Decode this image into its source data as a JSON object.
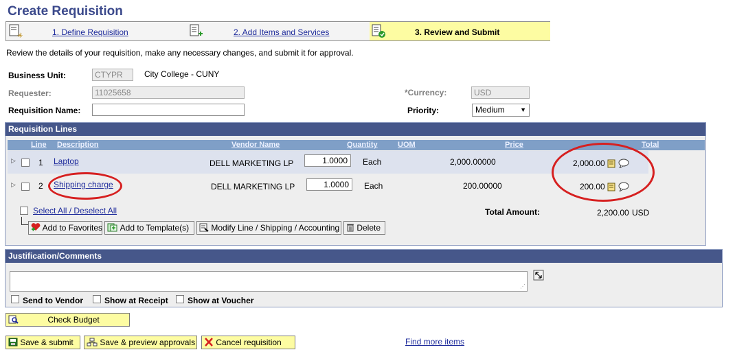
{
  "page": {
    "title": "Create Requisition",
    "intro": "Review the details of your requisition, make any necessary changes, and submit it for approval."
  },
  "steps": [
    {
      "label": "1. Define Requisition",
      "icon": "define-requisition-icon"
    },
    {
      "label": "2. Add Items and Services",
      "icon": "add-items-icon"
    },
    {
      "label": "3. Review and Submit",
      "icon": "review-submit-icon"
    }
  ],
  "header": {
    "business_unit_label": "Business Unit:",
    "business_unit_value": "CTYPR",
    "business_unit_desc": "City College - CUNY",
    "requester_label": "Requester:",
    "requester_value": "11025658",
    "currency_label": "*Currency:",
    "currency_value": "USD",
    "requisition_name_label": "Requisition Name:",
    "requisition_name_value": "",
    "priority_label": "Priority:",
    "priority_value": "Medium"
  },
  "lines": {
    "title": "Requisition Lines",
    "columns": [
      "Line",
      "Description",
      "Vendor Name",
      "Quantity",
      "UOM",
      "Price",
      "Total"
    ],
    "rows": [
      {
        "line": "1",
        "description": "Laptop",
        "vendor": "DELL MARKETING LP",
        "quantity": "1.0000",
        "uom": "Each",
        "price": "2,000.00000",
        "total": "2,000.00"
      },
      {
        "line": "2",
        "description": "Shipping charge",
        "vendor": "DELL MARKETING LP",
        "quantity": "1.0000",
        "uom": "Each",
        "price": "200.00000",
        "total": "200.00"
      }
    ],
    "select_all": "Select All / Deselect All",
    "total_amount_label": "Total Amount:",
    "total_amount_value": "2,200.00",
    "total_currency": "USD",
    "actions": {
      "add_favorites": "Add to Favorites",
      "add_template": "Add to Template(s)",
      "modify_line": "Modify Line / Shipping / Accounting",
      "delete": "Delete"
    }
  },
  "justification": {
    "title": "Justification/Comments",
    "text": "",
    "send_to_vendor": "Send to Vendor",
    "show_at_receipt": "Show at Receipt",
    "show_at_voucher": "Show at Voucher"
  },
  "footer": {
    "check_budget": "Check Budget",
    "save_submit": "Save & submit",
    "save_preview": "Save & preview approvals",
    "cancel": "Cancel requisition",
    "find_more": "Find more items"
  },
  "colors": {
    "accent": "#46578a",
    "grid_header": "#7f9fc7",
    "highlight": "#fdfca2",
    "annotation": "#d62020"
  }
}
